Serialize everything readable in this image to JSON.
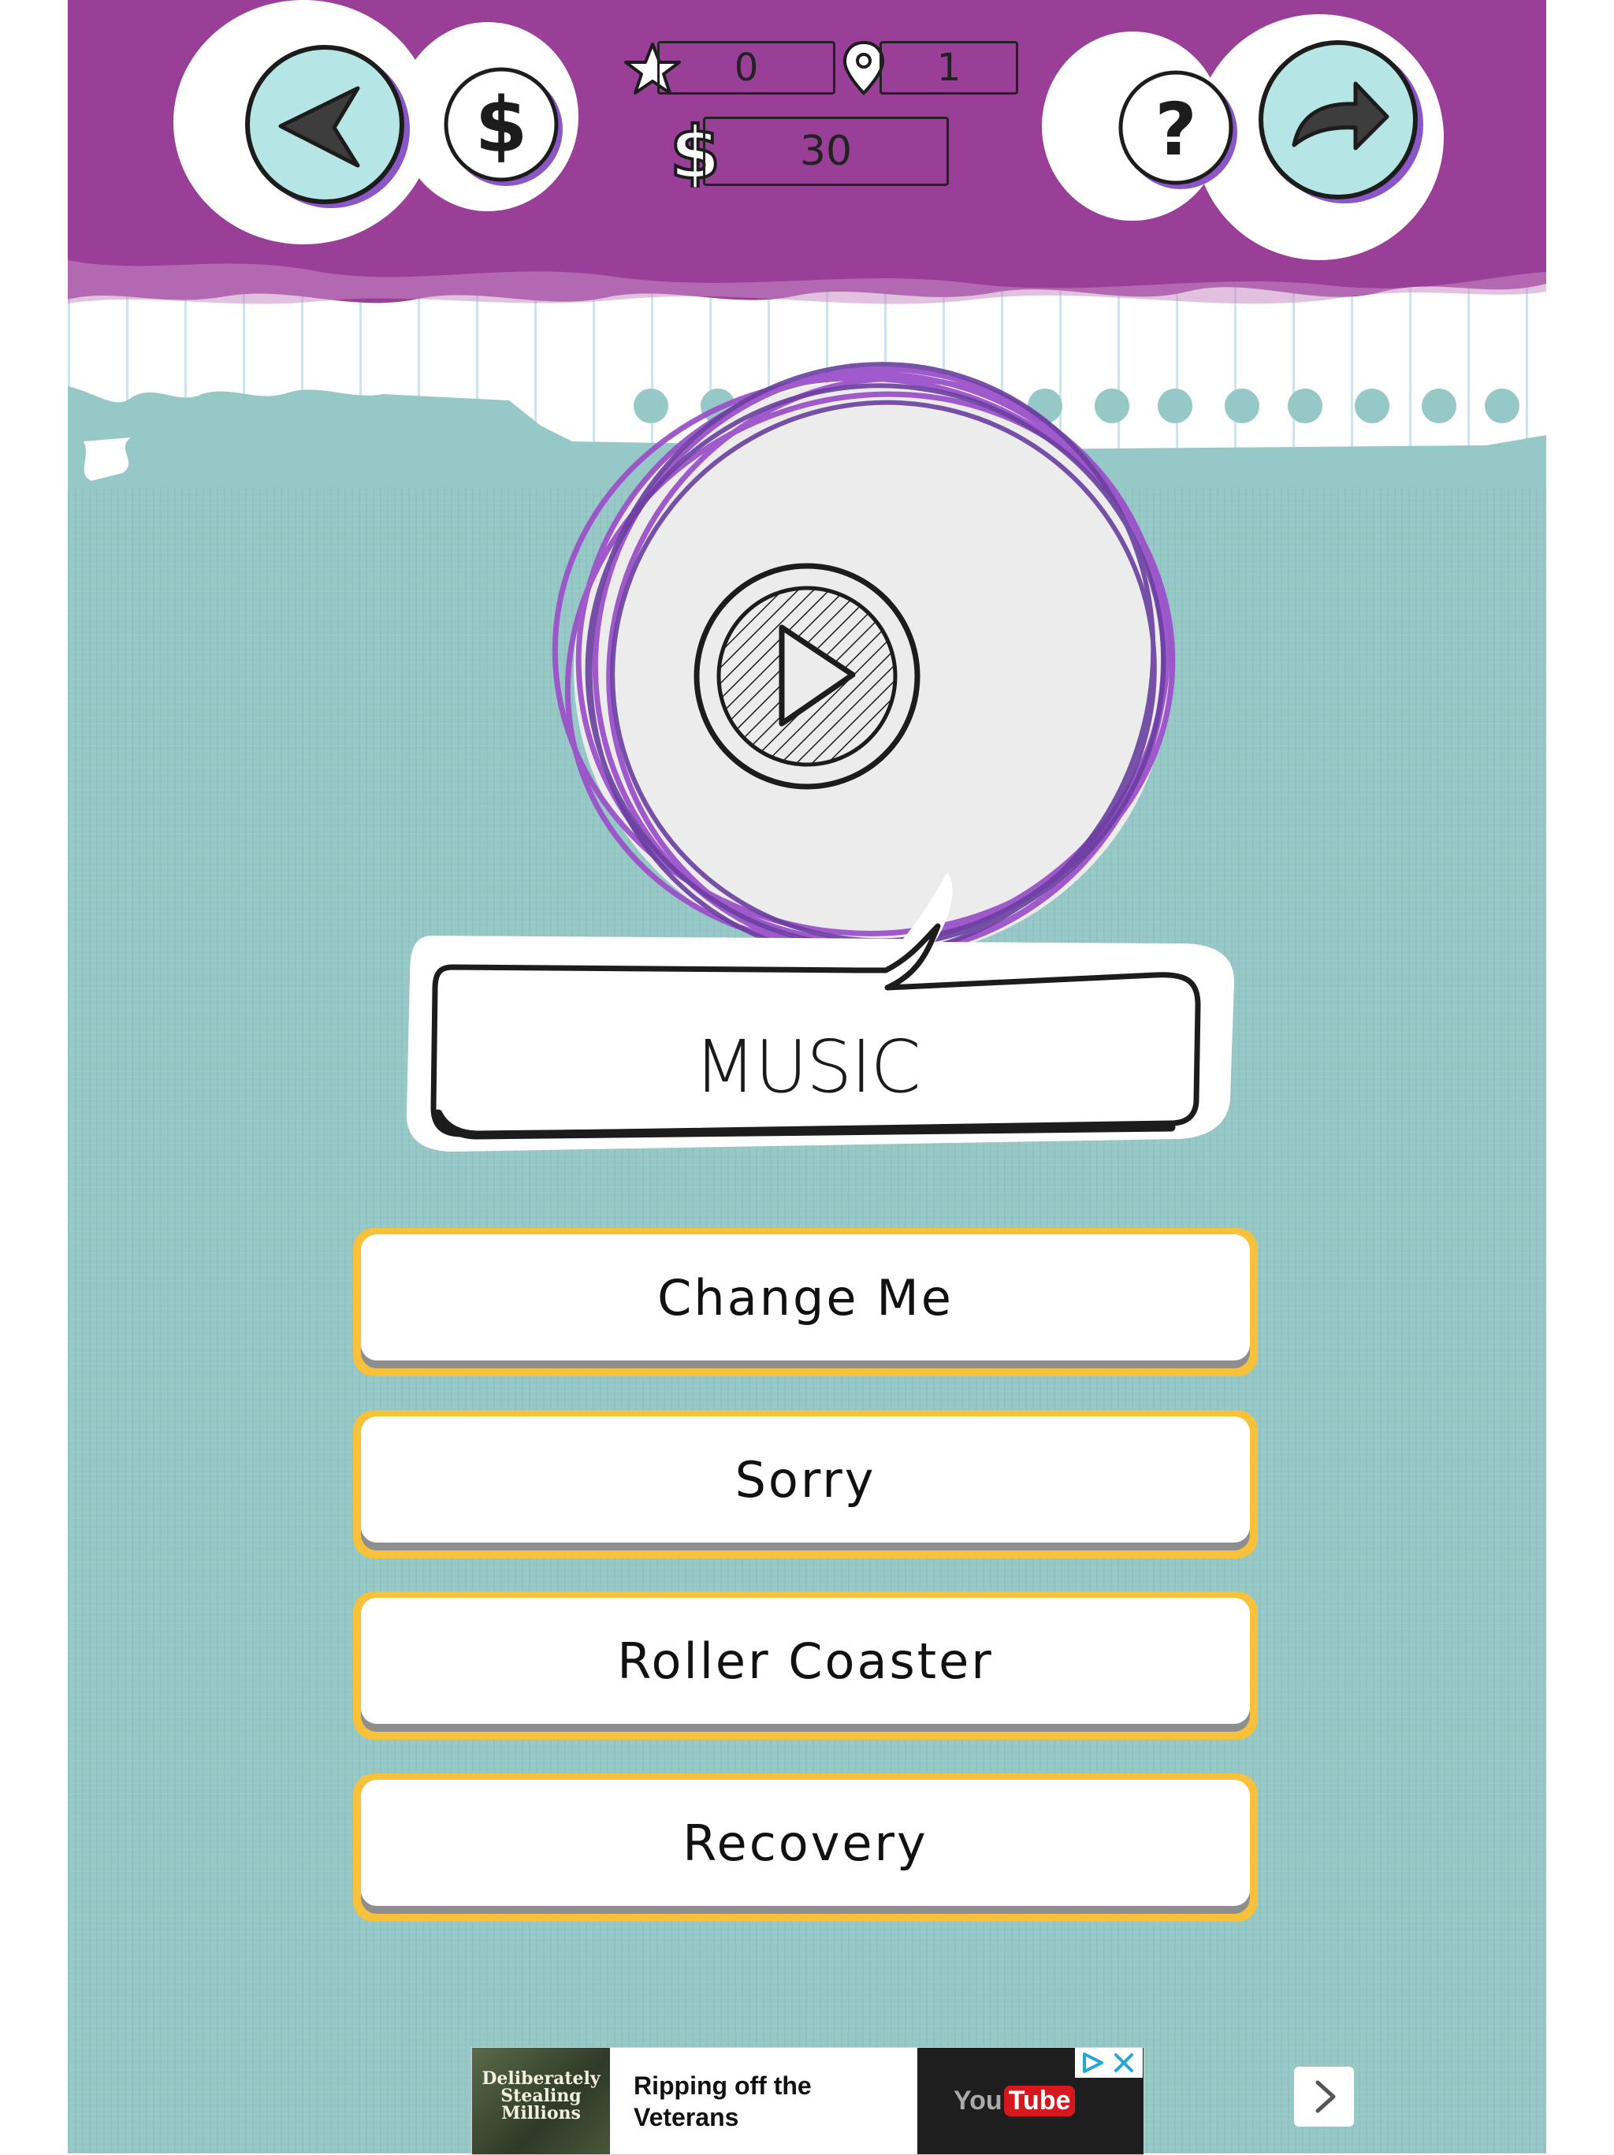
{
  "header": {
    "stars": "0",
    "level": "1",
    "coins": "30",
    "icons": {
      "back": "back-arrow-icon",
      "shop": "dollar-icon",
      "star": "star-icon",
      "level": "map-pin-icon",
      "coins": "dollar-icon",
      "help": "question-icon",
      "share": "share-arrow-icon"
    }
  },
  "play": {
    "icon": "play-icon"
  },
  "category": "MUSIC",
  "answers": [
    "Change Me",
    "Sorry",
    "Roller Coaster",
    "Recovery"
  ],
  "ad": {
    "thumb_text": [
      "Deliberately",
      "Stealing",
      "Millions"
    ],
    "headline": "Ripping off the Veterans",
    "video_brand_you": "You",
    "video_brand_tube": "Tube",
    "next_icon": "chevron-right-icon",
    "adchoices_icon": "adchoices-icon",
    "close_icon": "close-icon"
  },
  "colors": {
    "header_purple": "#9a3f98",
    "background_teal": "#95c8c6",
    "button_border": "#f7c13a",
    "scribble_purple": "#9c52c9"
  }
}
